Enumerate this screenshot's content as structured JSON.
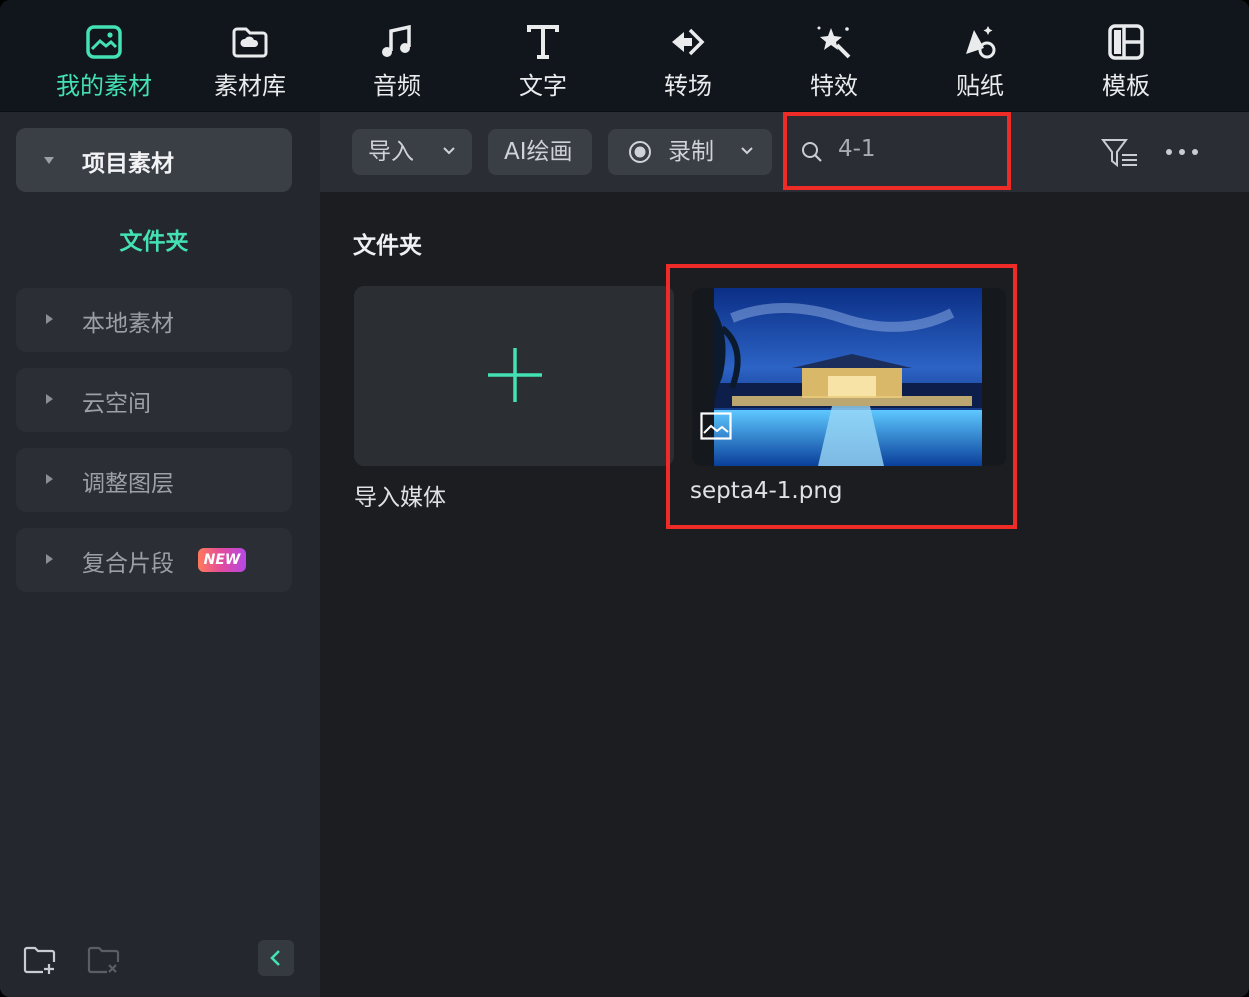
{
  "app": {
    "toolbar": [
      {
        "key": "my_media",
        "label": "我的素材",
        "icon": "media-icon",
        "active": true
      },
      {
        "key": "library",
        "label": "素材库",
        "icon": "cloud-folder-icon",
        "active": false
      },
      {
        "key": "audio",
        "label": "音频",
        "icon": "music-note-icon",
        "active": false
      },
      {
        "key": "text",
        "label": "文字",
        "icon": "text-t-icon",
        "active": false
      },
      {
        "key": "transition",
        "label": "转场",
        "icon": "transition-icon",
        "active": false
      },
      {
        "key": "effects",
        "label": "特效",
        "icon": "magic-wand-icon",
        "active": false
      },
      {
        "key": "stickers",
        "label": "贴纸",
        "icon": "sticker-icon",
        "active": false
      },
      {
        "key": "templates",
        "label": "模板",
        "icon": "template-icon",
        "active": false
      }
    ],
    "sidebar": {
      "project_media": "项目素材",
      "folder_label": "文件夹",
      "items": [
        {
          "label": "本地素材"
        },
        {
          "label": "云空间"
        },
        {
          "label": "调整图层"
        },
        {
          "label": "复合片段",
          "badge": "NEW"
        }
      ]
    },
    "main": {
      "buttons": {
        "import": "导入",
        "ai_paint": "AI绘画",
        "record": "录制"
      },
      "search": {
        "value": "4-1",
        "icon": "search-icon"
      },
      "section_title": "文件夹",
      "import_card_label": "导入媒体",
      "media_items": [
        {
          "name": "septa4-1.png",
          "type": "image"
        }
      ]
    },
    "colors": {
      "accent": "#43e1b3",
      "highlight_box": "#ef2b27",
      "background": "#1b1d21",
      "sidebar": "#24272d",
      "toolbar": "#11161c"
    }
  }
}
